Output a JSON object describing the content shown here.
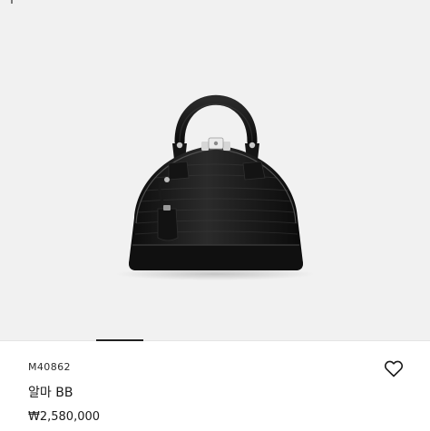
{
  "product": {
    "sku": "M40862",
    "name": "알마 BB",
    "price": "₩2,580,000"
  },
  "carousel": {
    "active_index": 0
  },
  "icons": {
    "wishlist": "heart-icon"
  },
  "colors": {
    "image_background": "#f1f1f1",
    "bag": "#151515",
    "text": "#1a1a1a",
    "indicator": "#222222"
  }
}
